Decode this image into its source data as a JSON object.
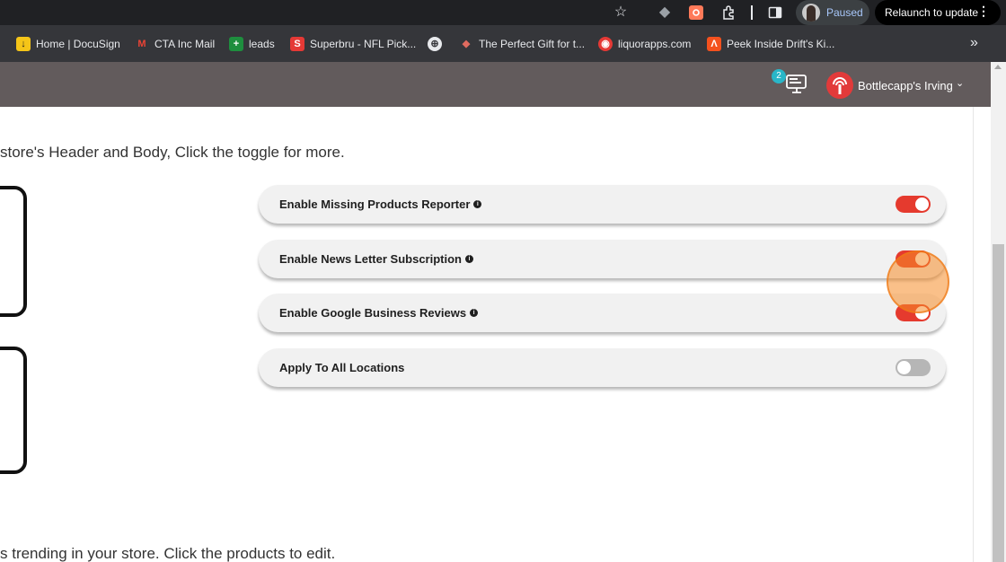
{
  "browser": {
    "paused_label": "Paused",
    "relaunch_label": "Relaunch to update",
    "bookmarks": [
      {
        "label": "Home | DocuSign",
        "icon": "docusign-icon",
        "color": "#f5c518"
      },
      {
        "label": "CTA Inc Mail",
        "icon": "gmail-icon",
        "color": "#ea4335"
      },
      {
        "label": "leads",
        "icon": "sheets-icon",
        "color": "#1e8e3e"
      },
      {
        "label": "Superbru - NFL Pick...",
        "icon": "superbru-icon",
        "color": "#e53935"
      },
      {
        "label": "",
        "icon": "globe-icon",
        "color": "#e8eaed"
      },
      {
        "label": "The Perfect Gift for t...",
        "icon": "gift-icon",
        "color": "#e06b5f"
      },
      {
        "label": "liquorapps.com",
        "icon": "liquorapps-icon",
        "color": "#e53935"
      },
      {
        "label": "Peek Inside Drift's Ki...",
        "icon": "drift-icon",
        "color": "#f4511e"
      }
    ]
  },
  "header": {
    "notification_count": "2",
    "store_name": "Bottlecapp's Irving"
  },
  "content": {
    "intro_text": "store's Header and Body, Click the toggle for more.",
    "bottom_text": "s trending in your store. Click the products to edit.",
    "toggles": [
      {
        "label": "Enable Missing Products Reporter",
        "has_info": true,
        "state": "on"
      },
      {
        "label": "Enable News Letter Subscription",
        "has_info": true,
        "state": "on"
      },
      {
        "label": "Enable Google Business Reviews",
        "has_info": true,
        "state": "on"
      },
      {
        "label": "Apply To All Locations",
        "has_info": false,
        "state": "off"
      }
    ]
  },
  "colors": {
    "toggle_on": "#e53a2e",
    "toggle_off": "#b6b6b6",
    "header_bg": "#625b5c",
    "click_indicator": "#f58c28"
  }
}
